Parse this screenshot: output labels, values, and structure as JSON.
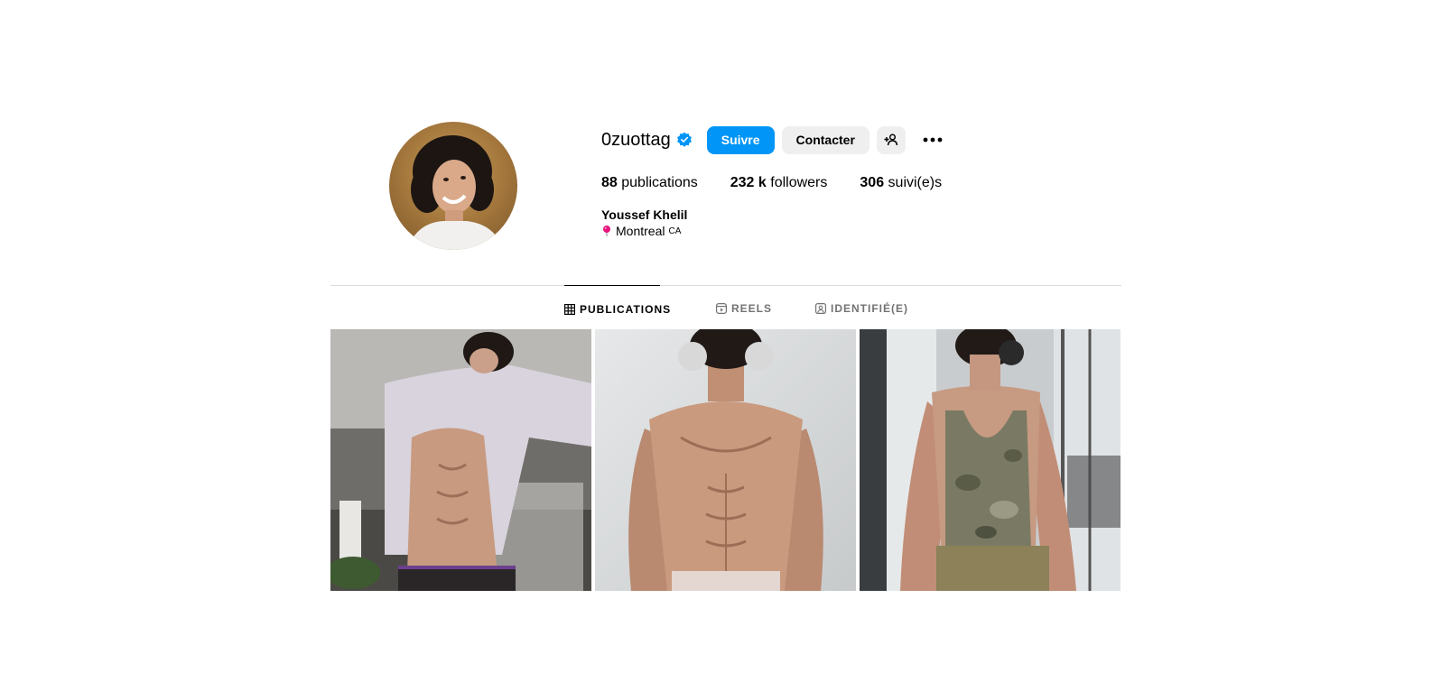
{
  "profile": {
    "username": "0zuottag",
    "verified": true,
    "follow_label": "Suivre",
    "contact_label": "Contacter",
    "stats": {
      "publications_count": "88",
      "publications_label": "publications",
      "followers_count": "232 k",
      "followers_label": "followers",
      "following_count": "306",
      "following_label": "suivi(e)s"
    },
    "full_name": "Youssef Khelil",
    "location": "Montreal",
    "location_code": "CA"
  },
  "tabs": [
    {
      "label": "PUBLICATIONS",
      "active": true
    },
    {
      "label": "REELS",
      "active": false
    },
    {
      "label": "IDENTIFIÉ(E)",
      "active": false
    }
  ],
  "colors": {
    "primary": "#0095f6",
    "secondary_bg": "#efefef",
    "verified": "#0095f6",
    "divider": "#dbdbdb",
    "muted_text": "#737373"
  },
  "posts": [
    {
      "alt": "post-1"
    },
    {
      "alt": "post-2"
    },
    {
      "alt": "post-3"
    }
  ]
}
